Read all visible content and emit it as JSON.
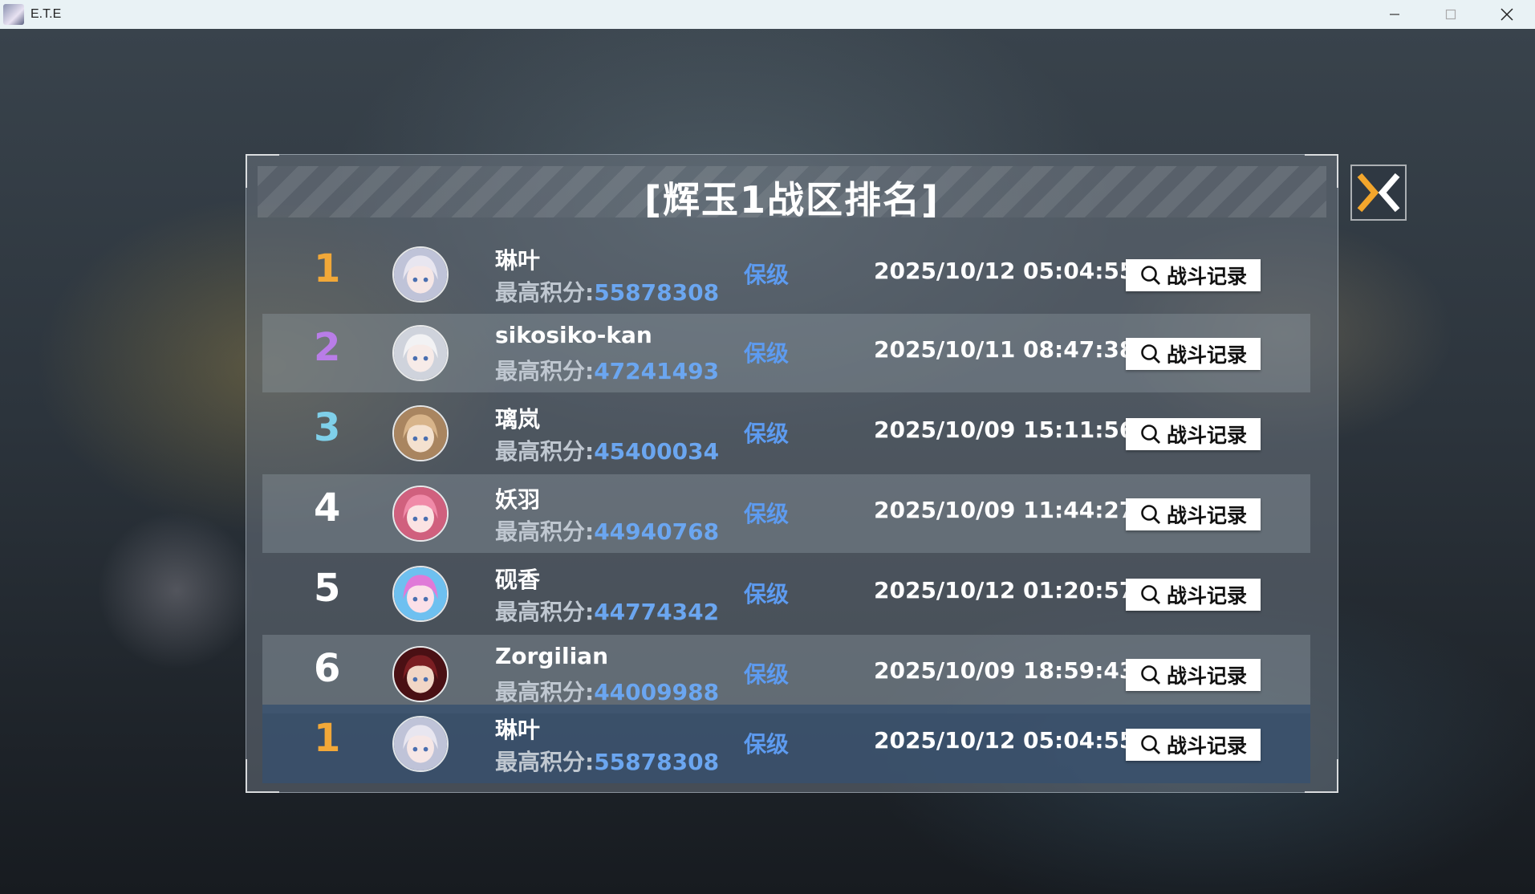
{
  "window": {
    "title": "E.T.E"
  },
  "panel": {
    "title": "[辉玉1战区排名]"
  },
  "colors": {
    "gold": "#f2a838",
    "purple": "#b97de8",
    "cyan": "#7fd0ea",
    "white": "#ffffff",
    "score": "#6ba6f0",
    "status": "#5d9bf0"
  },
  "rows": [
    {
      "rank": "1",
      "rank_color": "gold",
      "name": "琳叶",
      "score_label": "最高积分:",
      "score": "55878308",
      "status": "保级",
      "time": "2025/10/12 05:04:55",
      "button": "战斗记录",
      "avatar": "silver-hair-girl-avatar"
    },
    {
      "rank": "2",
      "rank_color": "purple",
      "name": "sikosiko-kan",
      "score_label": "最高积分:",
      "score": "47241493",
      "status": "保级",
      "time": "2025/10/11 08:47:38",
      "button": "战斗记录",
      "avatar": "white-hair-girl-avatar"
    },
    {
      "rank": "3",
      "rank_color": "cyan",
      "name": "璃岚",
      "score_label": "最高积分:",
      "score": "45400034",
      "status": "保级",
      "time": "2025/10/09 15:11:56",
      "button": "战斗记录",
      "avatar": "blonde-girl-avatar"
    },
    {
      "rank": "4",
      "rank_color": "white",
      "name": "妖羽",
      "score_label": "最高积分:",
      "score": "44940768",
      "status": "保级",
      "time": "2025/10/09 11:44:27",
      "button": "战斗记录",
      "avatar": "pink-hair-girl-avatar"
    },
    {
      "rank": "5",
      "rank_color": "white",
      "name": "砚香",
      "score_label": "最高积分:",
      "score": "44774342",
      "status": "保级",
      "time": "2025/10/12 01:20:57",
      "button": "战斗记录",
      "avatar": "magenta-hair-girl-avatar"
    },
    {
      "rank": "6",
      "rank_color": "white",
      "name": "Zorgilian",
      "score_label": "最高积分:",
      "score": "44009988",
      "status": "保级",
      "time": "2025/10/09 18:59:43",
      "button": "战斗记录",
      "avatar": "red-hair-girl-avatar"
    }
  ],
  "self_row": {
    "rank": "1",
    "rank_color": "gold",
    "name": "琳叶",
    "score_label": "最高积分:",
    "score": "55878308",
    "status": "保级",
    "time": "2025/10/12 05:04:55",
    "button": "战斗记录",
    "avatar": "silver-hair-girl-avatar"
  }
}
